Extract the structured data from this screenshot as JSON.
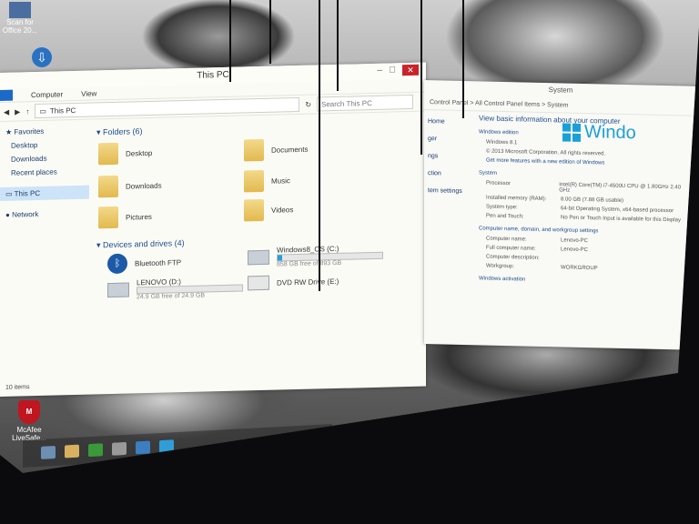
{
  "desktop": {
    "top_icon_label": "Scan for\nOffice 20...",
    "mcafee_label": "McAfee\nLiveSafe..."
  },
  "explorer": {
    "title": "This PC",
    "ribbon": {
      "tab_computer": "Computer",
      "tab_view": "View"
    },
    "address": {
      "path": "This PC",
      "search_placeholder": "Search This PC"
    },
    "nav": {
      "favorites": "Favorites",
      "desktop": "Desktop",
      "downloads": "Downloads",
      "recent": "Recent places",
      "this_pc": "This PC",
      "network": "Network"
    },
    "folders_header": "Folders (6)",
    "folders": [
      "Desktop",
      "Documents",
      "Downloads",
      "Music",
      "Pictures",
      "Videos"
    ],
    "devices_header": "Devices and drives (4)",
    "devices": {
      "bluetooth": "Bluetooth FTP",
      "os_drive": "Windows8_OS (C:)",
      "os_free": "858 GB free of 893 GB",
      "lenovo": "LENOVO (D:)",
      "lenovo_free": "24.9 GB free of 24.9 GB",
      "dvd": "DVD RW Drive (E:)"
    },
    "drive_usage": {
      "os_used_fraction": 0.04,
      "lenovo_used_fraction": 0.0
    },
    "status": "10 items"
  },
  "system": {
    "title": "System",
    "path": "Control Panel  >  All Control Panel Items  >  System",
    "sidebar": [
      "Home",
      "ger",
      "ngs",
      "ction",
      "tem settings"
    ],
    "heading": "View basic information about your computer",
    "edition_header": "Windows edition",
    "edition": "Windows 8.1",
    "copyright": "© 2013 Microsoft Corporation. All rights reserved.",
    "upgrade_link": "Get more features with a new edition of Windows",
    "logo_text": "Windo",
    "system_header": "System",
    "rows": [
      {
        "k": "Processor",
        "v": "Intel(R) Core(TM) i7-4500U CPU @ 1.80GHz  2.40 GHz"
      },
      {
        "k": "Installed memory (RAM):",
        "v": "8.00 GB (7.88 GB usable)"
      },
      {
        "k": "System type:",
        "v": "64-bit Operating System, x64-based processor"
      },
      {
        "k": "Pen and Touch:",
        "v": "No Pen or Touch Input is available for this Display"
      }
    ],
    "name_header": "Computer name, domain, and workgroup settings",
    "name_rows": [
      {
        "k": "Computer name:",
        "v": "Lenovo-PC"
      },
      {
        "k": "Full computer name:",
        "v": "Lenovo-PC"
      },
      {
        "k": "Computer description:",
        "v": ""
      },
      {
        "k": "Workgroup:",
        "v": "WORKGROUP"
      }
    ],
    "activation_header": "Windows activation"
  },
  "colors": {
    "accent": "#1b6ac9",
    "close": "#c7242b",
    "folder": "#e2b94e",
    "win_blue": "#1aa0d8"
  }
}
